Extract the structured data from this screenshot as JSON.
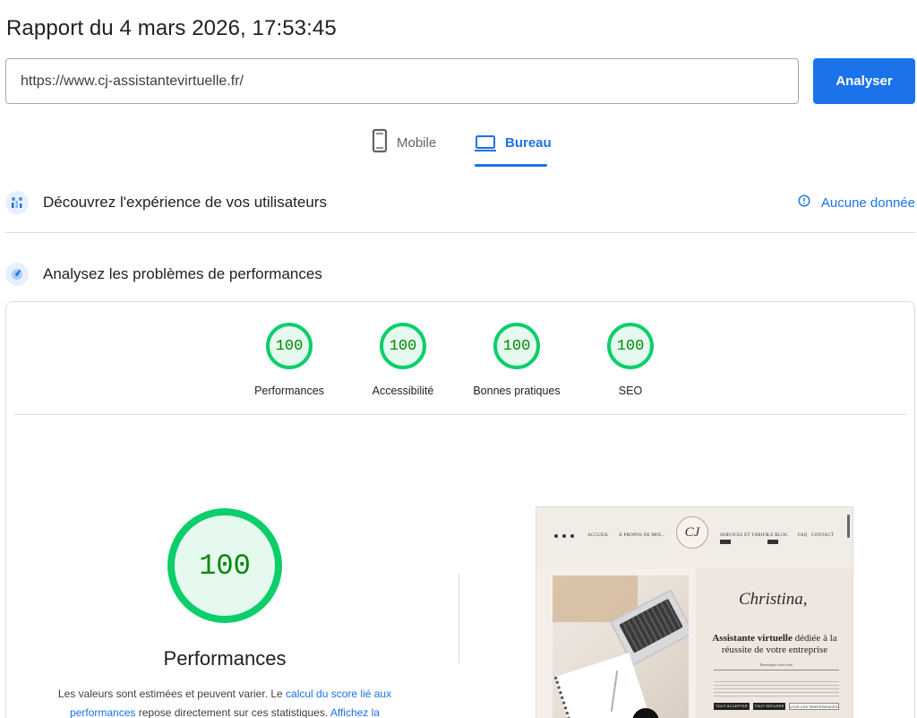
{
  "header": {
    "title": "Rapport du 4 mars 2026, 17:53:45"
  },
  "search": {
    "url_value": "https://www.cj-assistantevirtuelle.fr/",
    "analyze_label": "Analyser"
  },
  "device_tabs": {
    "mobile_label": "Mobile",
    "desktop_label": "Bureau",
    "selected": "Bureau"
  },
  "sections": {
    "field_data_title": "Découvrez l'expérience de vos utilisateurs",
    "field_data_status": "Aucune donnée",
    "lab_title": "Analysez les problèmes de performances"
  },
  "scores": [
    {
      "label": "Performances",
      "value": "100"
    },
    {
      "label": "Accessibilité",
      "value": "100"
    },
    {
      "label": "Bonnes pratiques",
      "value": "100"
    },
    {
      "label": "SEO",
      "value": "100"
    }
  ],
  "main_score": {
    "value": "100",
    "label": "Performances"
  },
  "disclaimer": {
    "part1": "Les valeurs sont estimées et peuvent varier. Le ",
    "link1": "calcul du score lié aux performances",
    "part2": " repose directement sur ces statistiques. ",
    "link2": "Affichez la"
  },
  "thumbnail": {
    "nav_items": [
      "ACCUEIL",
      "À PROPOS DE MOI...",
      "SERVICES ET TARIFS",
      "LE BLOG",
      "FAQ",
      "CONTACT"
    ],
    "logo_text": "CJ",
    "script_name": "Christina,",
    "headline_bold": "Assistante virtuelle",
    "headline_rest": " dédiée à la réussite de votre entreprise",
    "form_placeholder": "Renseignez votre texte",
    "buttons": [
      "TOUT ACCEPTER",
      "TOUT REFUSER",
      "VOIR LES PRÉFÉRENCES"
    ]
  },
  "colors": {
    "accent": "#1a73e8",
    "score_good": "#0cce6b",
    "score_text": "#008800",
    "score_fill": "#e6f9ef"
  },
  "icons": {
    "mobile": "smartphone-icon",
    "desktop": "laptop-icon",
    "field_data": "users-chart-icon",
    "lab": "speed-gauge-icon",
    "status": "info-circle-icon"
  }
}
